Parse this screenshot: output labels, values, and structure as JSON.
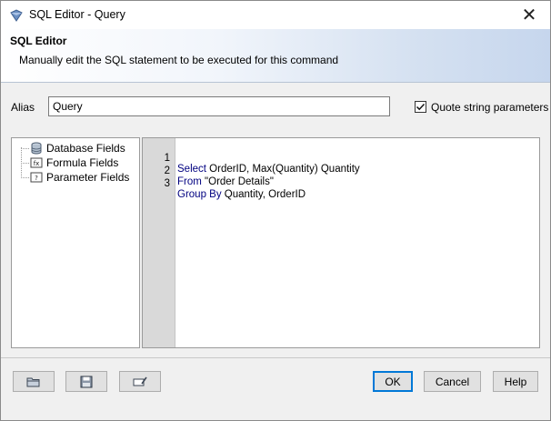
{
  "window": {
    "title": "SQL Editor - Query",
    "close_glyph": "✕"
  },
  "banner": {
    "title": "SQL Editor",
    "description": "Manually edit the SQL statement to be executed for this command"
  },
  "alias": {
    "label": "Alias",
    "value": "Query"
  },
  "quote_params": {
    "label": "Quote string parameters",
    "checked": true,
    "check_glyph": "✓"
  },
  "tree": {
    "items": [
      {
        "label": "Database Fields",
        "icon": "database-icon"
      },
      {
        "label": "Formula Fields",
        "icon": "formula-icon"
      },
      {
        "label": "Parameter Fields",
        "icon": "parameter-icon"
      }
    ]
  },
  "editor": {
    "lines": [
      {
        "num": "1",
        "keyword": "Select",
        "rest": " OrderID, Max(Quantity) Quantity"
      },
      {
        "num": "2",
        "keyword": "From",
        "rest": " \"Order Details\""
      },
      {
        "num": "3",
        "keyword": "Group By",
        "rest": " Quantity, OrderID"
      }
    ],
    "keyword_color": "#000080"
  },
  "buttons": {
    "open_icon": "open-folder-icon",
    "save_icon": "save-icon",
    "edit_icon": "edit-icon",
    "ok": "OK",
    "cancel": "Cancel",
    "help": "Help"
  }
}
